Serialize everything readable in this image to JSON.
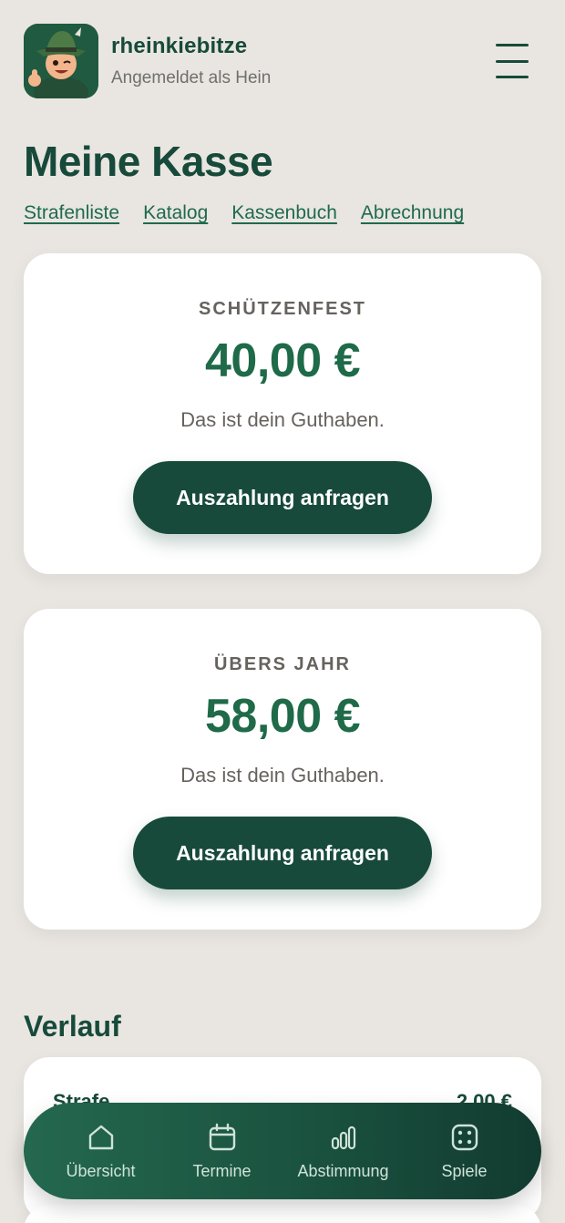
{
  "header": {
    "app_name": "rheinkiebitze",
    "subtitle": "Angemeldet als Hein"
  },
  "page": {
    "title": "Meine Kasse"
  },
  "subnav": [
    {
      "label": "Strafenliste"
    },
    {
      "label": "Katalog"
    },
    {
      "label": "Kassenbuch"
    },
    {
      "label": "Abrechnung"
    }
  ],
  "balances": [
    {
      "label": "SCHÜTZENFEST",
      "amount": "40,00 €",
      "note": "Das ist dein Guthaben.",
      "button": "Auszahlung anfragen"
    },
    {
      "label": "ÜBERS JAHR",
      "amount": "58,00 €",
      "note": "Das ist dein Guthaben.",
      "button": "Auszahlung anfragen"
    }
  ],
  "history": {
    "title": "Verlauf",
    "items": [
      {
        "type": "Strafe",
        "amount": "2,00 €"
      }
    ]
  },
  "bottom_nav": [
    {
      "label": "Übersicht",
      "icon": "home-icon"
    },
    {
      "label": "Termine",
      "icon": "calendar-icon"
    },
    {
      "label": "Abstimmung",
      "icon": "bar-chart-icon"
    },
    {
      "label": "Spiele",
      "icon": "dice-icon"
    }
  ],
  "colors": {
    "brand_dark": "#174a3a",
    "amount_green": "#1f6a48",
    "background": "#e9e6e1"
  }
}
